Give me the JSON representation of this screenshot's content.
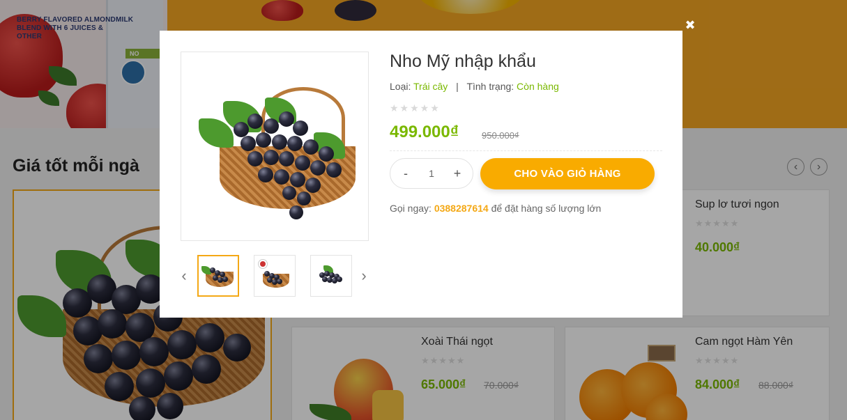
{
  "banner": {
    "carton_text": "BERRY FLAVORED ALMONDMILK\nBLEND WITH 6 JUICES &\nOTHER",
    "carton_tag": "NO",
    "colors": {
      "banner_bg": "#f5a623"
    }
  },
  "section": {
    "title": "Giá tốt mỗi ngà",
    "prev_icon": "chevron-left-icon",
    "next_icon": "chevron-right-icon"
  },
  "products": [
    {
      "name": "Sup lơ tươi ngon",
      "rating": 0,
      "price": "40.000₫",
      "old_price": ""
    },
    {
      "name": "Xoài Thái ngọt",
      "rating": 0,
      "price": "65.000₫",
      "old_price": "70.000₫"
    },
    {
      "name": "Cam ngọt Hàm Yên",
      "rating": 0,
      "price": "84.000₫",
      "old_price": "88.000₫"
    }
  ],
  "quickview": {
    "title": "Nho Mỹ nhập khẩu",
    "type_label": "Loại:",
    "type_value": "Trái cây",
    "separator": "|",
    "status_label": "Tình trạng:",
    "status_value": "Còn hàng",
    "rating": 0,
    "stars": "★★★★★",
    "price": "499.000₫",
    "old_price": "950.000₫",
    "quantity": "1",
    "minus": "-",
    "plus": "+",
    "add_to_cart": "CHO VÀO GIỎ HÀNG",
    "call_prefix": "Gọi ngay:",
    "phone": "0388287614",
    "call_suffix": "để đặt hàng số lượng lớn",
    "thumbnails": [
      "grapes-basket",
      "grapes-usa",
      "grapes-bunch"
    ],
    "active_thumbnail": 0,
    "close_icon": "close-icon"
  },
  "colors": {
    "accent_green": "#7ab800",
    "accent_orange": "#f9ab00",
    "thumb_border": "#f4a815"
  }
}
